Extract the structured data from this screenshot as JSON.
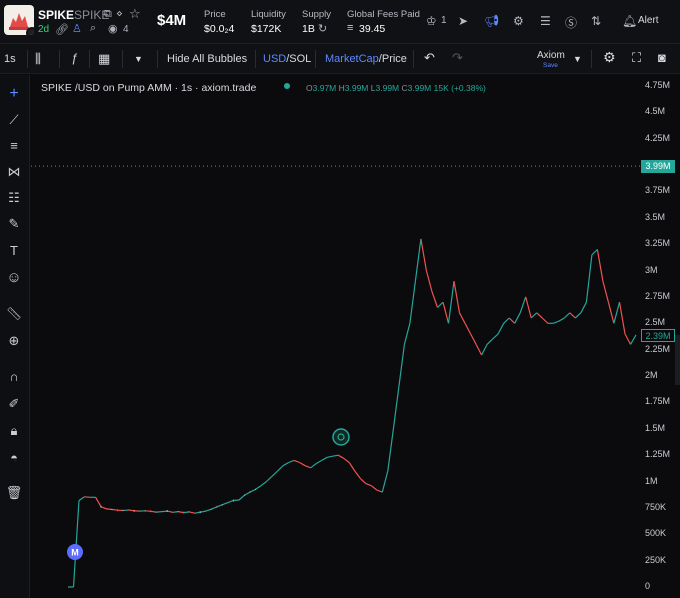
{
  "header": {
    "token_name": "SPIKE",
    "token_symbol": "SPIKE",
    "age": "2d",
    "holders": "4",
    "market_cap": "$4M",
    "stats": [
      {
        "label": "Price",
        "value": "$0.0₂4"
      },
      {
        "label": "Liquidity",
        "value": "$172K"
      },
      {
        "label": "Supply",
        "value": "1B"
      },
      {
        "label": "Global Fees Paid",
        "value": "39.45"
      }
    ],
    "nav_count": "1",
    "alert_label": "Alert"
  },
  "toolbar": {
    "interval": "1s",
    "hide_bubbles": "Hide All Bubbles",
    "currency_a": "USD",
    "currency_b": "/SOL",
    "mode_a": "MarketCap",
    "mode_b": "/Price",
    "layout_name": "Axiom",
    "layout_save": "Save"
  },
  "legend": {
    "title": "SPIKE /USD on Pump AMM · 1s · axiom.trade",
    "open_label": "O",
    "open": "3.97M",
    "high_label": "H",
    "high": "3.99M",
    "low_label": "L",
    "low": "3.99M",
    "close_label": "C",
    "close": "3.99M",
    "change": "15K (+0.38%)"
  },
  "price_axis": {
    "ticks": [
      "4.75M",
      "4.5M",
      "4.25M",
      "3.75M",
      "3.5M",
      "3.25M",
      "3M",
      "2.75M",
      "2.5M",
      "2.25M",
      "2M",
      "1.75M",
      "1.5M",
      "1.25M",
      "1M",
      "750K",
      "500K",
      "250K",
      "0"
    ],
    "current_tag": "3.99M",
    "last_tag": "2.39M"
  },
  "markers": {
    "migration_badge": "M"
  },
  "colors": {
    "up": "#26a69a",
    "down": "#ef5350",
    "accent": "#5c89ff",
    "background": "#0b0b0d"
  },
  "chart_data": {
    "type": "line",
    "title": "SPIKE /USD on Pump AMM · 1s · axiom.trade",
    "y_unit": "USD market cap",
    "ylim": [
      0,
      4900000
    ],
    "grid": false,
    "current_value": 3990000,
    "series": [
      {
        "values": [
          0,
          0,
          820000,
          855000,
          850000,
          850000,
          760000,
          740000,
          735000,
          728000,
          725000,
          730000,
          722000,
          720000,
          722000,
          718000,
          710000,
          715000,
          720000,
          708000,
          715000,
          705000,
          712000,
          700000,
          710000,
          720000,
          738000,
          760000,
          780000,
          800000,
          820000,
          825000,
          870000,
          900000,
          925000,
          960000,
          1000000,
          1050000,
          1100000,
          1150000,
          1180000,
          1200000,
          1180000,
          1150000,
          1130000,
          1170000,
          1200000,
          1230000,
          1240000,
          1250000,
          1220000,
          1180000,
          1100000,
          1030000,
          980000,
          960000,
          920000,
          900000,
          1100000,
          1500000,
          1900000,
          2300000,
          2500000,
          2900000,
          3300000,
          3000000,
          2800000,
          2650000,
          2700000,
          2500000,
          2900000,
          2600000,
          2500000,
          2400000,
          2300000,
          2200000,
          2300000,
          2350000,
          2400000,
          2500000,
          2550000,
          2500000,
          2600000,
          2750000,
          2550000,
          2600000,
          2550000,
          2500000,
          2500000,
          2520000,
          2550000,
          2600000,
          2550000,
          2600000,
          2700000,
          3150000,
          3200000,
          2900000,
          2700000,
          2500000,
          2700000,
          2400000,
          2300000,
          2390000
        ]
      }
    ]
  }
}
